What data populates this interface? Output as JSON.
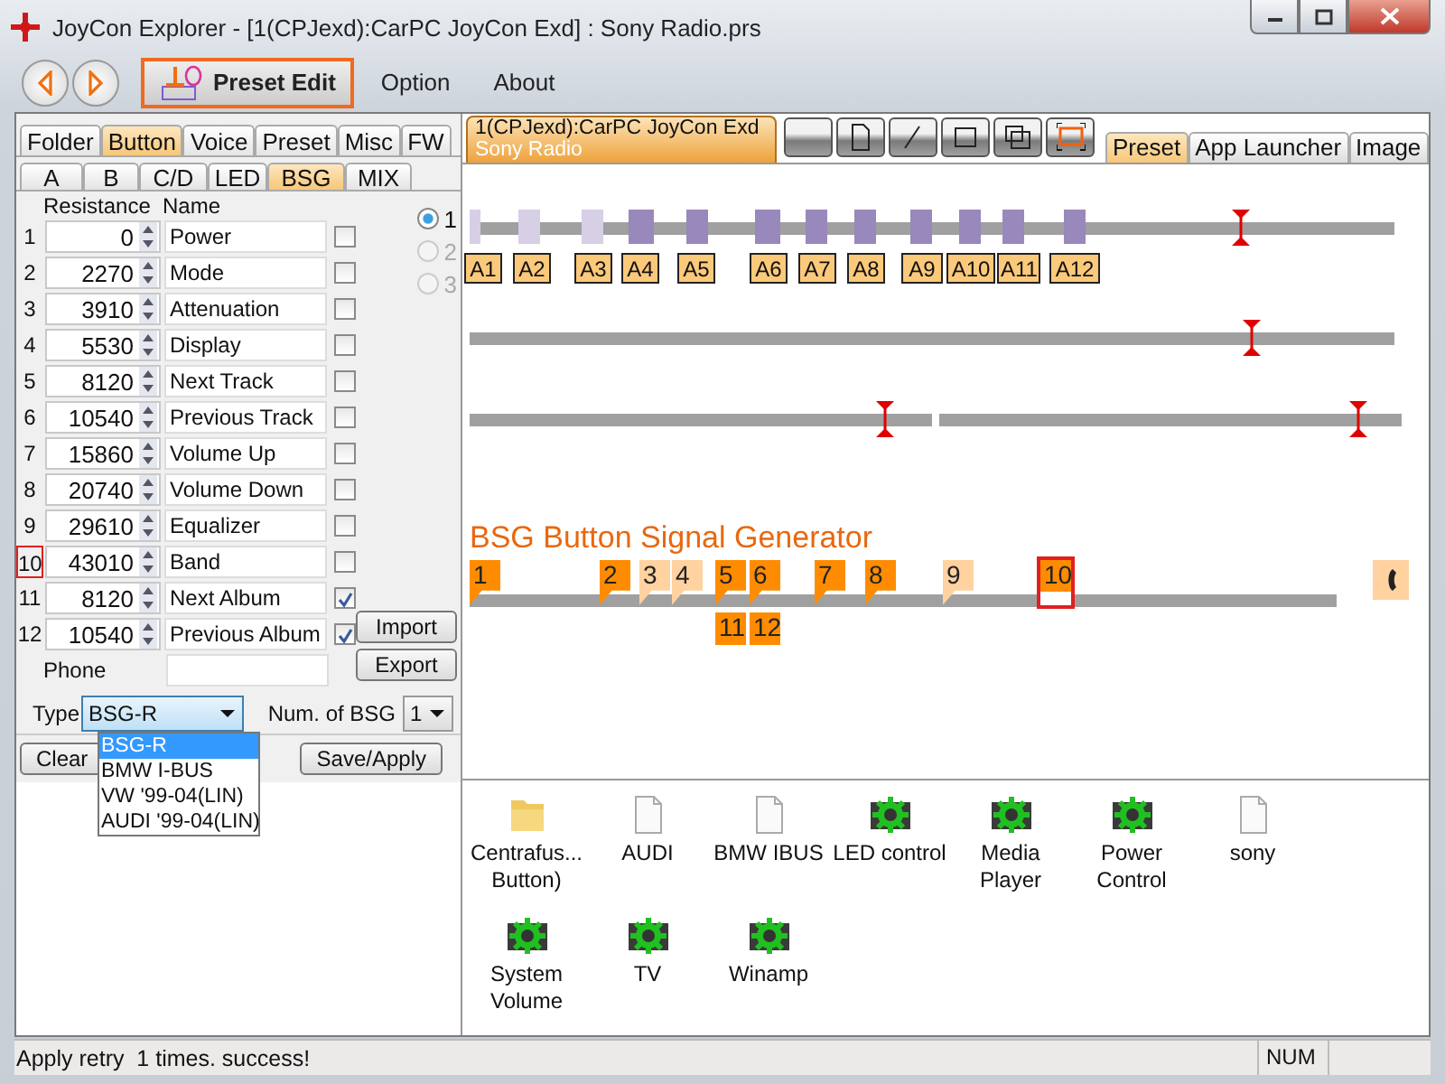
{
  "window": {
    "title": "JoyCon Explorer - [1(CPJexd):CarPC JoyCon Exd] : Sony Radio.prs"
  },
  "toolbar": {
    "items": [
      {
        "label": "Preset Edit",
        "selected": true
      },
      {
        "label": "Option",
        "selected": false
      },
      {
        "label": "About",
        "selected": false
      }
    ]
  },
  "left_panel": {
    "tabs": [
      {
        "label": "Folder",
        "selected": false
      },
      {
        "label": "Button",
        "selected": true
      },
      {
        "label": "Voice",
        "selected": false
      },
      {
        "label": "Preset",
        "selected": false
      },
      {
        "label": "Misc",
        "selected": false
      },
      {
        "label": "FW",
        "selected": false
      }
    ],
    "subtabs": [
      {
        "label": "A",
        "selected": false
      },
      {
        "label": "B",
        "selected": false
      },
      {
        "label": "C/D",
        "selected": false
      },
      {
        "label": "LED",
        "selected": false
      },
      {
        "label": "BSG",
        "selected": true
      },
      {
        "label": "MIX",
        "selected": false
      }
    ],
    "columns": [
      "Resistance",
      "Name"
    ],
    "rows": [
      {
        "number": "1",
        "resistance": "0",
        "name": "Power",
        "checked": false,
        "selected": false
      },
      {
        "number": "2",
        "resistance": "2270",
        "name": "Mode",
        "checked": false,
        "selected": false
      },
      {
        "number": "3",
        "resistance": "3910",
        "name": "Attenuation",
        "checked": false,
        "selected": false
      },
      {
        "number": "4",
        "resistance": "5530",
        "name": "Display",
        "checked": false,
        "selected": false
      },
      {
        "number": "5",
        "resistance": "8120",
        "name": "Next Track",
        "checked": false,
        "selected": false
      },
      {
        "number": "6",
        "resistance": "10540",
        "name": "Previous Track",
        "checked": false,
        "selected": false
      },
      {
        "number": "7",
        "resistance": "15860",
        "name": "Volume Up",
        "checked": false,
        "selected": false
      },
      {
        "number": "8",
        "resistance": "20740",
        "name": "Volume Down",
        "checked": false,
        "selected": false
      },
      {
        "number": "9",
        "resistance": "29610",
        "name": "Equalizer",
        "checked": false,
        "selected": false
      },
      {
        "number": "10",
        "resistance": "43010",
        "name": "Band",
        "checked": false,
        "selected": true
      },
      {
        "number": "11",
        "resistance": "8120",
        "name": "Next Album",
        "checked": true,
        "selected": false
      },
      {
        "number": "12",
        "resistance": "10540",
        "name": "Previous Album",
        "checked": true,
        "selected": false
      }
    ],
    "phone_label": "Phone",
    "radios": [
      {
        "label": "1",
        "selected": true,
        "disabled": false
      },
      {
        "label": "2",
        "selected": false,
        "disabled": true
      },
      {
        "label": "3",
        "selected": false,
        "disabled": true
      }
    ],
    "side_buttons": [
      "Import",
      "Export"
    ],
    "type": {
      "label": "Type",
      "value": "BSG-R",
      "expanded": true,
      "options": [
        {
          "label": "BSG-R",
          "selected": true
        },
        {
          "label": "BMW I-BUS",
          "selected": false
        },
        {
          "label": "VW '99-04(LIN)",
          "selected": false
        },
        {
          "label": "AUDI '99-04(LIN)",
          "selected": false
        }
      ]
    },
    "num_bsg": {
      "label": "Num. of BSG",
      "value": "1"
    },
    "actions": [
      "Clear",
      "Save/Apply"
    ]
  },
  "right_panel": {
    "document_tab": {
      "title": "1(CPJexd):CarPC JoyCon Exd",
      "subtitle": "Sony Radio"
    },
    "view_tabs": [
      {
        "label": "Preset",
        "selected": true
      },
      {
        "label": "App Launcher",
        "selected": false
      },
      {
        "label": "Image",
        "selected": false
      }
    ],
    "track_buttons": [
      {
        "label": "A1",
        "active": false
      },
      {
        "label": "A2",
        "active": false
      },
      {
        "label": "A3",
        "active": false
      },
      {
        "label": "A4",
        "active": true
      },
      {
        "label": "A5",
        "active": true
      },
      {
        "label": "A6",
        "active": true
      },
      {
        "label": "A7",
        "active": true
      },
      {
        "label": "A8",
        "active": true
      },
      {
        "label": "A9",
        "active": true
      },
      {
        "label": "A10",
        "active": true
      },
      {
        "label": "A11",
        "active": true
      },
      {
        "label": "A12",
        "active": true
      }
    ],
    "bsg_title": "BSG Button Signal Generator",
    "bsg_markers": [
      {
        "label": "1",
        "active": true,
        "selected": false
      },
      {
        "label": "2",
        "active": true,
        "selected": false
      },
      {
        "label": "3",
        "active": false,
        "selected": false
      },
      {
        "label": "4",
        "active": false,
        "selected": false
      },
      {
        "label": "5",
        "active": true,
        "selected": false
      },
      {
        "label": "6",
        "active": true,
        "selected": false
      },
      {
        "label": "7",
        "active": true,
        "selected": false
      },
      {
        "label": "8",
        "active": true,
        "selected": false
      },
      {
        "label": "9",
        "active": false,
        "selected": false
      },
      {
        "label": "10",
        "active": true,
        "selected": true
      },
      {
        "label": "11",
        "active": true,
        "selected": false
      },
      {
        "label": "12",
        "active": true,
        "selected": false
      }
    ],
    "files": [
      {
        "label": "Centrafus...\nButton)",
        "kind": "folder"
      },
      {
        "label": "AUDI",
        "kind": "file"
      },
      {
        "label": "BMW IBUS",
        "kind": "file"
      },
      {
        "label": "LED control",
        "kind": "app"
      },
      {
        "label": "Media\nPlayer",
        "kind": "app"
      },
      {
        "label": "Power\nControl",
        "kind": "app"
      },
      {
        "label": "sony",
        "kind": "file"
      },
      {
        "label": "System\nVolume",
        "kind": "app"
      },
      {
        "label": "TV",
        "kind": "app"
      },
      {
        "label": "Winamp",
        "kind": "app"
      }
    ]
  },
  "status_bar": {
    "message": "Apply retry  1 times. success!",
    "indicators": [
      "NUM"
    ]
  }
}
